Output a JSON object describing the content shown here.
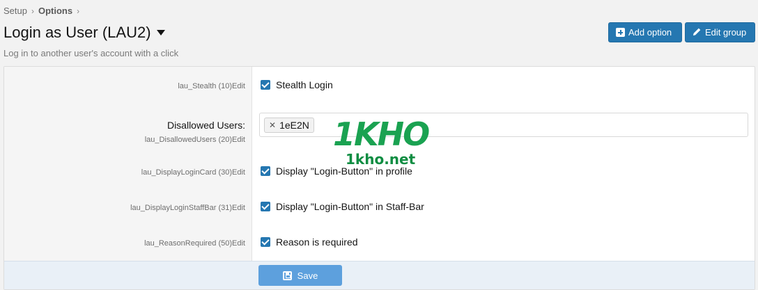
{
  "breadcrumb": {
    "items": [
      "Setup",
      "Options"
    ]
  },
  "header": {
    "title": "Login as User (LAU2)",
    "description": "Log in to another user's account with a click",
    "add_option_label": "Add option",
    "edit_group_label": "Edit group"
  },
  "options": [
    {
      "key": "lau_Stealth (10)",
      "edit": "Edit",
      "value": "Stealth Login",
      "checked": true
    },
    {
      "label": "Disallowed Users:",
      "key": "lau_DisallowedUsers (20)",
      "edit": "Edit",
      "tokens": [
        "1eE2N"
      ]
    },
    {
      "key": "lau_DisplayLoginCard (30)",
      "edit": "Edit",
      "value": "Display \"Login-Button\" in profile",
      "checked": true
    },
    {
      "key": "lau_DisplayLoginStaffBar (31)",
      "edit": "Edit",
      "value": "Display \"Login-Button\" in Staff-Bar",
      "checked": true
    },
    {
      "key": "lau_ReasonRequired (50)",
      "edit": "Edit",
      "value": "Reason is required",
      "checked": true
    }
  ],
  "footer": {
    "save_label": "Save"
  },
  "watermark": {
    "logo": "1KHO",
    "url": "1kho.net"
  },
  "colors": {
    "primary": "#2577b1",
    "save": "#5da0dd",
    "footer_bg": "#e9f0f7",
    "watermark": "#1aa251"
  }
}
